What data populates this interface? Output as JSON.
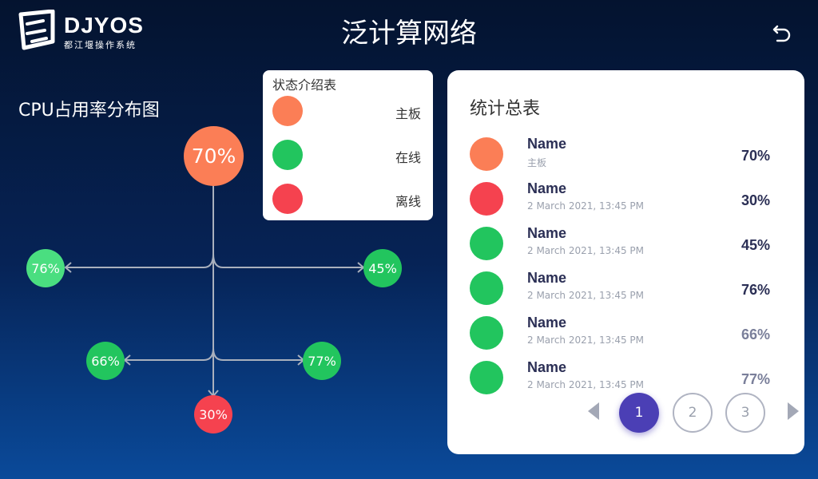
{
  "header": {
    "logo_text": "DJYOS",
    "logo_subtitle": "都江堰操作系统",
    "title": "泛计算网络",
    "back_icon": "back-arrow-icon"
  },
  "diagram": {
    "title": "CPU占用率分布图",
    "nodes": {
      "root": {
        "label": "70%",
        "value": 70,
        "status": "主板"
      },
      "left_1": {
        "label": "76%",
        "value": 76,
        "status": "在线"
      },
      "right_1": {
        "label": "45%",
        "value": 45,
        "status": "在线"
      },
      "left_2": {
        "label": "66%",
        "value": 66,
        "status": "在线"
      },
      "right_2": {
        "label": "77%",
        "value": 77,
        "status": "在线"
      },
      "bottom": {
        "label": "30%",
        "value": 30,
        "status": "离线"
      }
    }
  },
  "legend": {
    "title": "状态介绍表",
    "items": [
      {
        "label": "主板",
        "color": "#fb7e56"
      },
      {
        "label": "在线",
        "color": "#22c55e"
      },
      {
        "label": "离线",
        "color": "#f5424f"
      }
    ]
  },
  "stats": {
    "title": "统计总表",
    "rows": [
      {
        "name": "Name",
        "sub": "主板",
        "value": "70%",
        "color": "#fb7e56"
      },
      {
        "name": "Name",
        "sub": "2 March 2021, 13:45 PM",
        "value": "30%",
        "color": "#f5424f"
      },
      {
        "name": "Name",
        "sub": "2 March 2021, 13:45 PM",
        "value": "45%",
        "color": "#22c55e"
      },
      {
        "name": "Name",
        "sub": "2 March 2021, 13:45 PM",
        "value": "76%",
        "color": "#22c55e"
      },
      {
        "name": "Name",
        "sub": "2 March 2021, 13:45 PM",
        "value": "66%",
        "color": "#22c55e"
      },
      {
        "name": "Name",
        "sub": "2 March 2021, 13:45 PM",
        "value": "77%",
        "color": "#22c55e"
      }
    ],
    "pagination": {
      "pages": [
        "1",
        "2",
        "3"
      ],
      "current": "1"
    }
  },
  "colors": {
    "motherboard": "#fb7e56",
    "online": "#22c55e",
    "offline": "#f5424f",
    "accent": "#4b3fb5",
    "light_green": "#4ade80"
  }
}
